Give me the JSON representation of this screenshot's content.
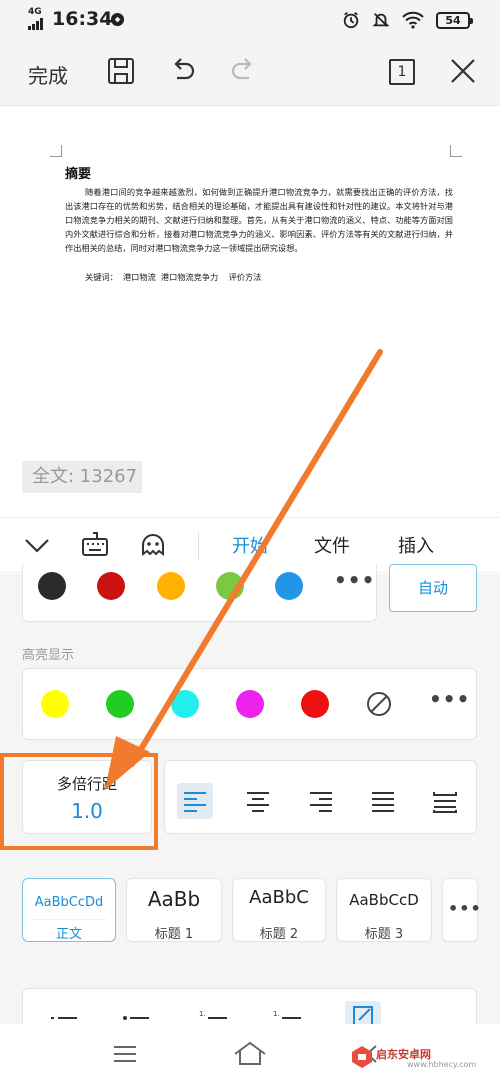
{
  "status_bar": {
    "network": "4G",
    "time": "16:34",
    "battery": "54"
  },
  "toolbar": {
    "done_label": "完成",
    "page_count": "1"
  },
  "document": {
    "heading": "摘要",
    "body": "随着港口间的竞争越来越激烈，如何做到正确提升港口物流竞争力，就需要找出正确的评价方法，找出该港口存在的优势和劣势，结合相关的理论基础，才能提出具有建设性和针对性的建议。本文将针对与港口物流竞争力相关的期刊、文献进行归纳和整理。首先，从有关于港口物流的涵义、特点、功能等方面对国内外文献进行综合和分析，接着对港口物流竞争力的涵义、影响因素、评价方法等有关的文献进行归纳，并作出相关的总结，同时对港口物流竞争力这一领域提出研究设想。",
    "keywords": "关键词：  港口物流  港口物流竞争力    评价方法",
    "word_count": "全文: 13267"
  },
  "ribbon": {
    "tabs": [
      "开始",
      "文件",
      "插入"
    ],
    "active_tab": "开始"
  },
  "panel": {
    "font_colors": [
      "#2b2b2b",
      "#cc1111",
      "#ffb300",
      "#7ac943",
      "#2196e8"
    ],
    "auto_label": "自动",
    "highlight_label": "高亮显示",
    "highlight_colors": [
      "#ffff00",
      "#22cc22",
      "#22eeee",
      "#ee22ee",
      "#ee1111"
    ],
    "line_spacing": {
      "label": "多倍行距",
      "value": "1.0"
    },
    "styles": [
      {
        "sample": "AaBbCcDd",
        "name": "正文"
      },
      {
        "sample": "AaBb",
        "name": "标题 1"
      },
      {
        "sample": "AaBbC",
        "name": "标题 2"
      },
      {
        "sample": "AaBbCcD",
        "name": "标题 3"
      }
    ],
    "accent_color": "#1a8cd8"
  },
  "watermark": {
    "brand": "启东安卓网",
    "url": "www.hbhecy.com"
  }
}
